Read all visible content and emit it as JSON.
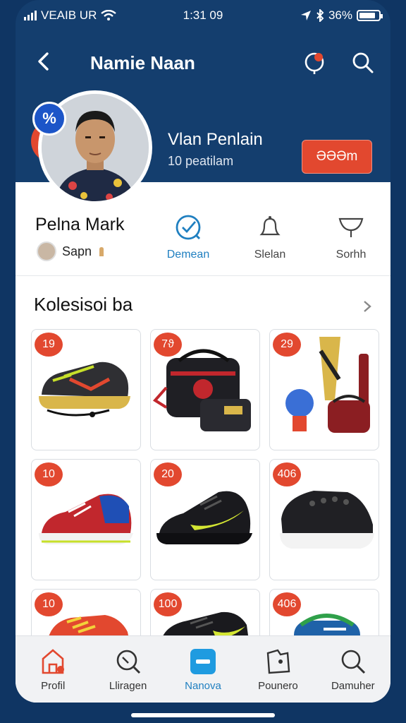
{
  "status_bar": {
    "carrier": "VEAIB UR",
    "time": "1:31 09",
    "battery_text": "36%",
    "battery_level": 0.85
  },
  "navbar": {
    "title": "Namie Naan"
  },
  "header": {
    "discount_badge": "%",
    "name": "Vlan Penlain",
    "subtitle": "10 peatilam",
    "action_label": "ƏƏƏm"
  },
  "profile": {
    "name": "Pelna Mark",
    "user_label": "Sapn"
  },
  "tabs": [
    {
      "label": "Demean",
      "icon": "check-circle-icon",
      "active": true
    },
    {
      "label": "Slelan",
      "icon": "bell-icon",
      "active": false
    },
    {
      "label": "Sorhh",
      "icon": "funnel-icon",
      "active": false
    }
  ],
  "section": {
    "title": "Kolesisoi ba"
  },
  "products": [
    {
      "badge": "19",
      "kind": "sneaker-dark"
    },
    {
      "badge": "7ϑ",
      "kind": "bag-set"
    },
    {
      "badge": "29",
      "kind": "sport-gear"
    },
    {
      "badge": "10",
      "kind": "sneaker-red-blue"
    },
    {
      "badge": "20",
      "kind": "sneaker-black-yellow"
    },
    {
      "badge": "406",
      "kind": "shoe-black"
    },
    {
      "badge": "10",
      "kind": "sneaker-red-yellow"
    },
    {
      "badge": "100",
      "kind": "sneaker-black"
    },
    {
      "badge": "406",
      "kind": "bag-blue"
    }
  ],
  "bottom_nav": [
    {
      "label": "Profil",
      "icon": "home-icon",
      "active": false
    },
    {
      "label": "Lliragen",
      "icon": "search-icon",
      "active": false
    },
    {
      "label": "Nanova",
      "icon": "minus-square-icon",
      "active": true
    },
    {
      "label": "Pounero",
      "icon": "puzzle-icon",
      "active": false
    },
    {
      "label": "Damuher",
      "icon": "search-icon",
      "active": false
    }
  ],
  "colors": {
    "brand_navy": "#143e6e",
    "accent_red": "#e2482f",
    "active_blue": "#1f7fc0"
  }
}
